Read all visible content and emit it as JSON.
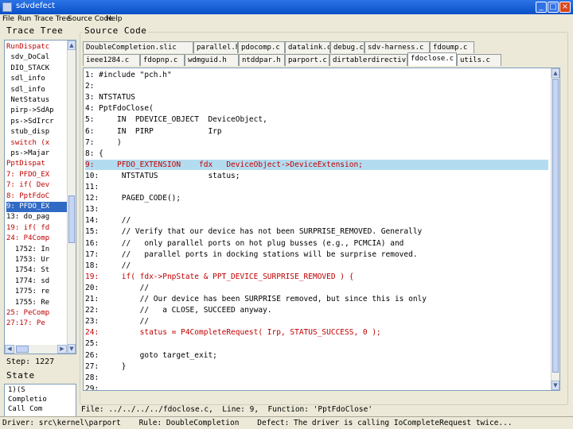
{
  "window": {
    "title": "sdvdefect"
  },
  "menu": [
    "File",
    "Run",
    "Trace Tree",
    "Source Code",
    "Help"
  ],
  "trace_tree": {
    "title": "Trace Tree",
    "lines": [
      {
        "text": "RunDispatc",
        "color": "#c00000",
        "selected": false
      },
      {
        "text": " sdv_DoCal",
        "color": "#000000",
        "selected": false
      },
      {
        "text": " DIO_STACK",
        "color": "#000000",
        "selected": false
      },
      {
        "text": " sdl_info",
        "color": "#000000",
        "selected": false
      },
      {
        "text": " sdl_info",
        "color": "#000000",
        "selected": false
      },
      {
        "text": " NetStatus",
        "color": "#000000",
        "selected": false
      },
      {
        "text": " pirp->SdAp",
        "color": "#000000",
        "selected": false
      },
      {
        "text": " ps->SdIrcr",
        "color": "#000000",
        "selected": false
      },
      {
        "text": " stub_disp",
        "color": "#000000",
        "selected": false
      },
      {
        "text": " switch (x",
        "color": "#c00000",
        "selected": false
      },
      {
        "text": " ps->Majar",
        "color": "#000000",
        "selected": false
      },
      {
        "text": "PptDispat",
        "color": "#c00000",
        "selected": false
      },
      {
        "text": "7: PFDO_EX",
        "color": "#c00000",
        "selected": false
      },
      {
        "text": "7: if( Dev",
        "color": "#c00000",
        "selected": false
      },
      {
        "text": "8: PptFdoC",
        "color": "#c00000",
        "selected": false
      },
      {
        "text": "9: PFDO_EX",
        "color": "#ffffff",
        "selected": true
      },
      {
        "text": "13: do_pag",
        "color": "#000000",
        "selected": false
      },
      {
        "text": "19: if( fd",
        "color": "#c00000",
        "selected": false
      },
      {
        "text": "24: P4Comp",
        "color": "#c00000",
        "selected": false
      },
      {
        "text": "  1752: In",
        "color": "#000000",
        "selected": false
      },
      {
        "text": "  1753: Ur",
        "color": "#000000",
        "selected": false
      },
      {
        "text": "  1754: St",
        "color": "#000000",
        "selected": false
      },
      {
        "text": "  1774: sd",
        "color": "#000000",
        "selected": false
      },
      {
        "text": "  1775: re",
        "color": "#000000",
        "selected": false
      },
      {
        "text": "  1755: Re",
        "color": "#000000",
        "selected": false
      },
      {
        "text": "25: PeComp",
        "color": "#c00000",
        "selected": false
      },
      {
        "text": "27:17: Pe",
        "color": "#c00000",
        "selected": false
      }
    ]
  },
  "step": {
    "label": "Step: 1227"
  },
  "state": {
    "title": "State",
    "lines": [
      "1)(S",
      "Completio",
      "Call Com"
    ]
  },
  "source_code": {
    "title": "Source Code",
    "tabs_row1": [
      "DoubleCompletion.slic",
      "parallel.h",
      "pdocomp.c",
      "datalink.c",
      "debug.c",
      "sdv-harness.c",
      "fdoump.c"
    ],
    "tabs_row2": [
      "ieee1284.c",
      "fdopnp.c",
      "wdmguid.h",
      "ntddpar.h",
      "parport.c",
      "dirtablerdirectiv",
      "fdoclose.c",
      "utils.c"
    ],
    "active_tab": "fdoclose.c",
    "lines": [
      {
        "ln": "1:",
        "text": " #include \"pch.h\"",
        "red": false,
        "hl": false
      },
      {
        "ln": "2:",
        "text": "",
        "red": false,
        "hl": false
      },
      {
        "ln": "3:",
        "text": " NTSTATUS",
        "red": false,
        "hl": false
      },
      {
        "ln": "4:",
        "text": " PptFdoClose(",
        "red": false,
        "hl": false
      },
      {
        "ln": "5:",
        "text": "     IN  PDEVICE_OBJECT  DeviceObject,",
        "red": false,
        "hl": false
      },
      {
        "ln": "6:",
        "text": "     IN  PIRP            Irp",
        "red": false,
        "hl": false
      },
      {
        "ln": "7:",
        "text": "     )",
        "red": false,
        "hl": false
      },
      {
        "ln": "8:",
        "text": " {",
        "red": false,
        "hl": false
      },
      {
        "ln": "9:",
        "text": "     PFDO_EXTENSION    fdx   DeviceObject->DeviceExtension;",
        "red": true,
        "hl": true
      },
      {
        "ln": "10:",
        "text": "     NTSTATUS           status;",
        "red": false,
        "hl": false
      },
      {
        "ln": "11:",
        "text": "",
        "red": false,
        "hl": false
      },
      {
        "ln": "12:",
        "text": "     PAGED_CODE();",
        "red": false,
        "hl": false
      },
      {
        "ln": "13:",
        "text": "",
        "red": false,
        "hl": false
      },
      {
        "ln": "14:",
        "text": "     //",
        "red": false,
        "hl": false
      },
      {
        "ln": "15:",
        "text": "     // Verify that our device has not been SURPRISE_REMOVED. Generally",
        "red": false,
        "hl": false
      },
      {
        "ln": "16:",
        "text": "     //   only parallel ports on hot plug busses (e.g., PCMCIA) and",
        "red": false,
        "hl": false
      },
      {
        "ln": "17:",
        "text": "     //   parallel ports in docking stations will be surprise removed.",
        "red": false,
        "hl": false
      },
      {
        "ln": "18:",
        "text": "     //",
        "red": false,
        "hl": false
      },
      {
        "ln": "19:",
        "text": "     if( fdx->PnpState & PPT_DEVICE_SURPRISE_REMOVED ) {",
        "red": true,
        "hl": false
      },
      {
        "ln": "20:",
        "text": "         //",
        "red": false,
        "hl": false
      },
      {
        "ln": "21:",
        "text": "         // Our device has been SURPRISE removed, but since this is only",
        "red": false,
        "hl": false
      },
      {
        "ln": "22:",
        "text": "         //   a CLOSE, SUCCEED anyway.",
        "red": false,
        "hl": false
      },
      {
        "ln": "23:",
        "text": "         //",
        "red": false,
        "hl": false
      },
      {
        "ln": "24:",
        "text": "         status = P4CompleteRequest( Irp, STATUS_SUCCESS, 0 );",
        "red": true,
        "hl": false
      },
      {
        "ln": "25:",
        "text": "",
        "red": false,
        "hl": false
      },
      {
        "ln": "26:",
        "text": "         goto target_exit;",
        "red": false,
        "hl": false
      },
      {
        "ln": "27:",
        "text": "     }",
        "red": false,
        "hl": false
      },
      {
        "ln": "28:",
        "text": "",
        "red": false,
        "hl": false
      },
      {
        "ln": "29:",
        "text": "",
        "red": false,
        "hl": false
      }
    ]
  },
  "bottom_info": "File: ../../../../fdoclose.c,  Line: 9,  Function: 'PptFdoClose'",
  "statusbar": "Driver: src\\kernel\\parport    Rule: DoubleCompletion    Defect: The driver is calling IoCompleteRequest twice..."
}
